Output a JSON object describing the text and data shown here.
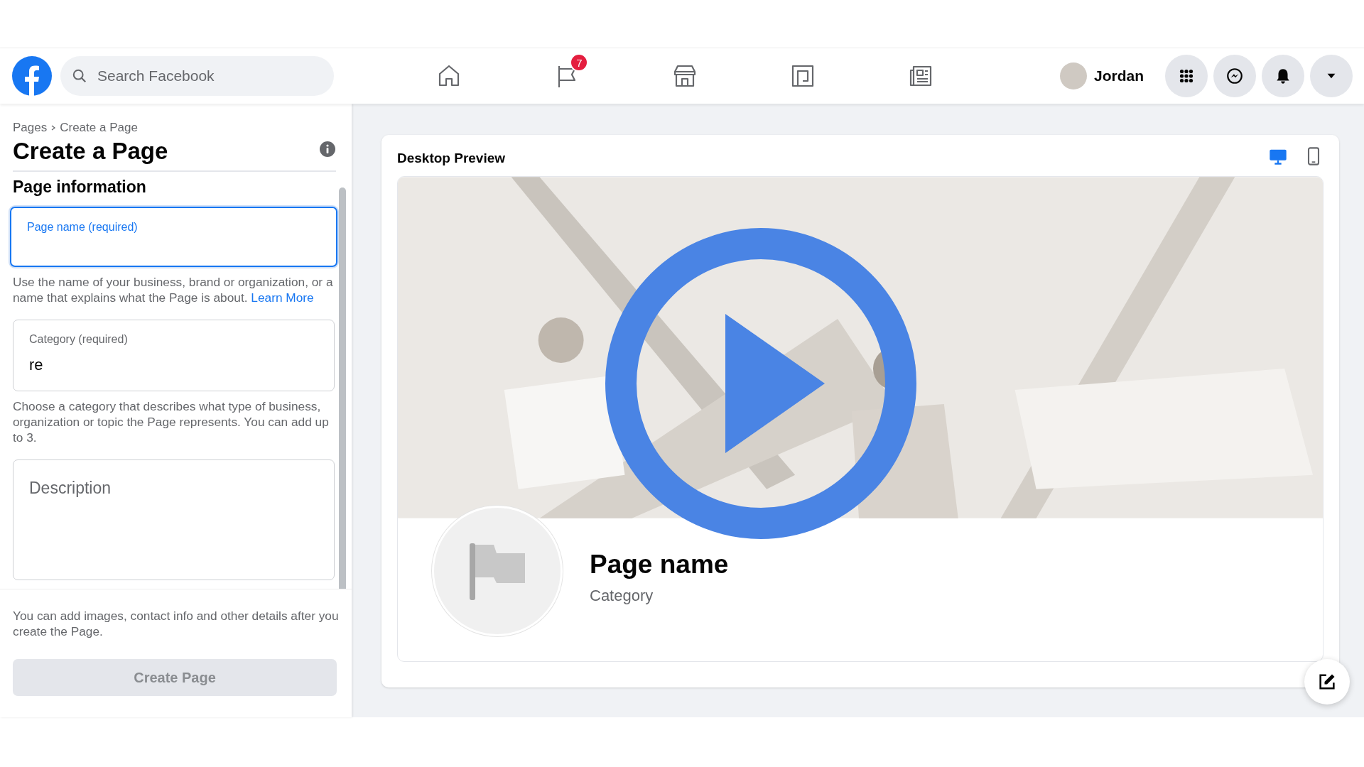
{
  "topbar": {
    "search": {
      "placeholder": "Search Facebook"
    },
    "nav": [
      {
        "kind": "home"
      },
      {
        "kind": "flag",
        "badge": "7"
      },
      {
        "kind": "store"
      },
      {
        "kind": "gaming"
      },
      {
        "kind": "news"
      }
    ],
    "user": {
      "name": "Jordan"
    },
    "actions": [
      {
        "kind": "apps"
      },
      {
        "kind": "messenger"
      },
      {
        "kind": "bell"
      },
      {
        "kind": "caret"
      }
    ]
  },
  "sidebar": {
    "breadcrumb": [
      "Pages",
      "Create a Page"
    ],
    "title": "Create a Page",
    "section": "Page information",
    "fields": [
      {
        "kind": "text",
        "label": "Page name (required)",
        "focused": true,
        "help": "Use the name of your business, brand or organization, or a name that explains what the Page is about.",
        "help_link": "Learn More"
      },
      {
        "kind": "text",
        "label": "Category (required)",
        "value": "re",
        "focused": false,
        "help": "Choose a category that describes what type of business, organization or topic the Page represents. You can add up to 3."
      },
      {
        "kind": "textarea",
        "placeholder": "Description",
        "focused": false
      }
    ],
    "footer_note": "You can add images, contact info and other details after you create the Page.",
    "button": {
      "label": "Create Page",
      "disabled": true
    }
  },
  "preview": {
    "title": "Desktop Preview",
    "views": [
      {
        "kind": "desktop",
        "selected": true
      },
      {
        "kind": "mobile",
        "selected": false
      }
    ],
    "page_name": "Page name",
    "category": "Category"
  }
}
